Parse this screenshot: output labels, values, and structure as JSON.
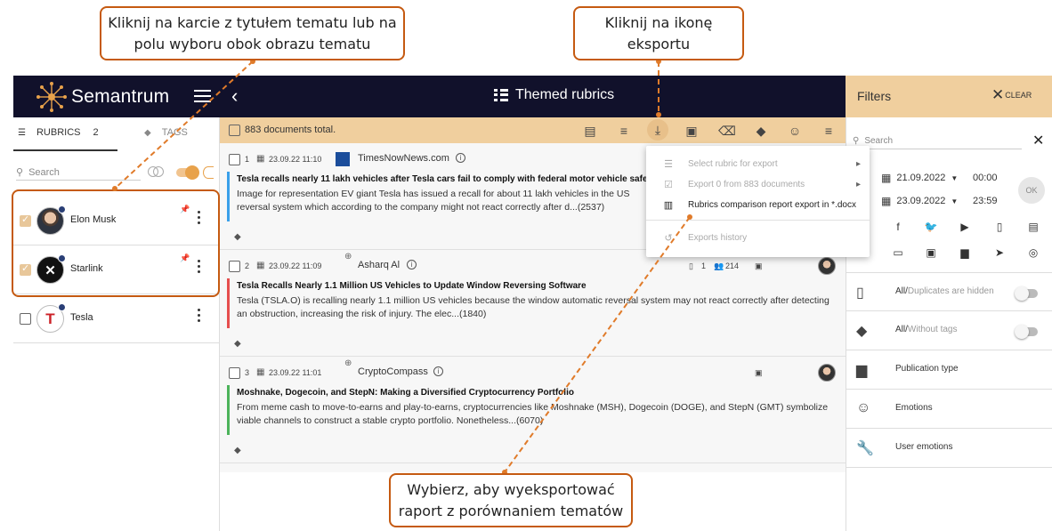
{
  "callouts": {
    "top_left": {
      "line1": "Kliknij na karcie z tytułem tematu lub na",
      "line2": "polu wyboru obok obrazu tematu"
    },
    "top_right": {
      "line1": "Kliknij na ikonę",
      "line2": "eksportu"
    },
    "bottom": {
      "line1": "Wybierz, aby wyeksportować",
      "line2": "raport z porównaniem tematów"
    }
  },
  "header": {
    "logo": "Semantrum",
    "title": "Themed rubrics",
    "back_icon": "chevron-left-icon",
    "menu_icon": "hamburger-icon"
  },
  "left_panel": {
    "tab_rubrics": "RUBRICS",
    "tab_rubrics_count": "2",
    "tab_tags": "TAGS",
    "search_placeholder": "Search",
    "rubrics": [
      {
        "name": "Elon Musk",
        "checked": true
      },
      {
        "name": "Starlink",
        "checked": true
      },
      {
        "name": "Tesla",
        "checked": false
      }
    ]
  },
  "toolbar": {
    "total": "883 documents total."
  },
  "documents": [
    {
      "num": "1",
      "date": "23.09.22 11:10",
      "source": "TimesNowNews.com",
      "headline": "Tesla recalls nearly 11 lakh vehicles after Tesla cars fail to comply with federal motor vehicle safe",
      "body": "Image for representation EV giant Tesla has issued a recall for about 11 lakh vehicles in the US",
      "body2": "reversal system which according to the company might not react correctly after d...(2537)",
      "color": "#3aa0ea"
    },
    {
      "num": "2",
      "date": "23.09.22 11:09",
      "source": "Asharq Al",
      "headline": "Tesla Recalls Nearly 1.1 Million US Vehicles to Update Window Reversing Software",
      "body": "Tesla (TSLA.O) is recalling nearly 1.1 million US vehicles because the window automatic reversal system may not react correctly after detecting",
      "body2": "an obstruction, increasing the risk of injury. The elec...(1840)",
      "meta1": "1",
      "meta2": "214",
      "color": "#e64e4e"
    },
    {
      "num": "3",
      "date": "23.09.22 11:01",
      "source": "CryptoCompass",
      "headline": "Moshnake, Dogecoin, and StepN: Making a Diversified Cryptocurrency Portfolio",
      "body": "From meme cash to move-to-earns and play-to-earns, cryptocurrencies like Moshnake (MSH), Dogecoin (DOGE), and StepN (GMT) symbolize",
      "body2": "viable channels to construct a stable crypto portfolio. Nonetheless...(6070)",
      "color": "#4cb35a"
    }
  ],
  "export_menu": {
    "items": [
      {
        "label": "Select rubric for export",
        "disabled": true,
        "has_submenu": true
      },
      {
        "label": "Export 0 from 883 documents",
        "disabled": true,
        "has_submenu": true
      },
      {
        "label": "Rubrics comparison report export in *.docx",
        "disabled": false,
        "has_submenu": false
      },
      {
        "label": "Exports history",
        "disabled": true,
        "has_submenu": false
      }
    ]
  },
  "filters": {
    "title": "Filters",
    "clear": "CLEAR",
    "search_placeholder": "Search",
    "date_from": "21.09.2022",
    "time_from": "00:00",
    "date_to": "23.09.2022",
    "time_to": "23:59",
    "ok": "OK",
    "rows": [
      {
        "label": "All",
        "sub": "Duplicates are hidden"
      },
      {
        "label": "All",
        "sub": "Without tags"
      },
      {
        "label": "Publication type"
      },
      {
        "label": "Emotions"
      },
      {
        "label": "User emotions"
      }
    ]
  }
}
